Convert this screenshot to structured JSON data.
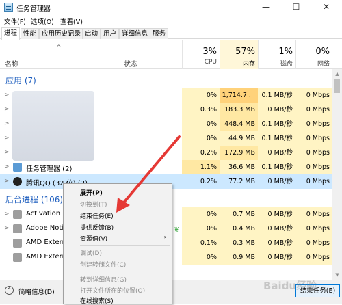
{
  "window": {
    "title": "任务管理器",
    "minimize_glyph": "—",
    "maximize_glyph": "☐",
    "close_glyph": "✕"
  },
  "menu": [
    "文件(F)",
    "选项(O)",
    "查看(V)"
  ],
  "tabs": [
    "进程",
    "性能",
    "应用历史记录",
    "启动",
    "用户",
    "详细信息",
    "服务"
  ],
  "header": {
    "sort_glyph": "^",
    "name": "名称",
    "status": "状态",
    "columns": [
      {
        "pct": "3%",
        "label": "CPU"
      },
      {
        "pct": "57%",
        "label": "内存"
      },
      {
        "pct": "1%",
        "label": "磁盘"
      },
      {
        "pct": "0%",
        "label": "网络"
      }
    ]
  },
  "groups": {
    "apps": "应用 (7)",
    "background": "后台进程 (106)"
  },
  "rows": [
    {
      "name": "",
      "cpu": "0%",
      "mem": "1,714.7 ...",
      "disk": "0.1 MB/秒",
      "net": "0 Mbps"
    },
    {
      "name": "",
      "cpu": "0.3%",
      "mem": "183.3 MB",
      "disk": "0 MB/秒",
      "net": "0 Mbps"
    },
    {
      "name": "",
      "cpu": "0%",
      "mem": "448.4 MB",
      "disk": "0.1 MB/秒",
      "net": "0 Mbps"
    },
    {
      "name": "",
      "cpu": "0%",
      "mem": "44.9 MB",
      "disk": "0.1 MB/秒",
      "net": "0 Mbps"
    },
    {
      "name": "",
      "cpu": "0.2%",
      "mem": "172.9 MB",
      "disk": "0 MB/秒",
      "net": "0 Mbps"
    },
    {
      "name": "任务管理器 (2)",
      "cpu": "1.1%",
      "mem": "36.6 MB",
      "disk": "0.1 MB/秒",
      "net": "0 Mbps"
    },
    {
      "name": "腾讯QQ (32 位) (2)",
      "cpu": "0.2%",
      "mem": "77.2 MB",
      "disk": "0 MB/秒",
      "net": "0 Mbps"
    },
    {
      "name": "Activation Li",
      "cpu": "0%",
      "mem": "0.7 MB",
      "disk": "0 MB/秒",
      "net": "0 Mbps"
    },
    {
      "name": "Adobe Noti",
      "cpu": "0%",
      "mem": "0.4 MB",
      "disk": "0 MB/秒",
      "net": "0 Mbps"
    },
    {
      "name": "AMD Extern",
      "cpu": "0.1%",
      "mem": "0.3 MB",
      "disk": "0 MB/秒",
      "net": "0 Mbps"
    },
    {
      "name": "AMD Extern",
      "cpu": "0%",
      "mem": "0.9 MB",
      "disk": "0 MB/秒",
      "net": "0 Mbps"
    }
  ],
  "context_menu": [
    {
      "label": "展开(P)",
      "state": "bold"
    },
    {
      "label": "切换到(T)",
      "state": "disabled"
    },
    {
      "label": "结束任务(E)",
      "state": "normal"
    },
    {
      "label": "提供反馈(B)",
      "state": "normal"
    },
    {
      "label": "资源值(V)",
      "state": "normal",
      "submenu_glyph": "›"
    },
    {
      "label": "调试(D)",
      "state": "disabled"
    },
    {
      "label": "创建转储文件(C)",
      "state": "disabled"
    },
    {
      "label": "转到详细信息(G)",
      "state": "disabled"
    },
    {
      "label": "打开文件所在的位置(O)",
      "state": "disabled"
    },
    {
      "label": "在线搜索(S)",
      "state": "normal"
    }
  ],
  "statusbar": {
    "toggle_glyph": "^",
    "summary": "简略信息(D)",
    "end_task": "结束任务(E)"
  },
  "watermark": "Baidu经验",
  "colors": {
    "heat_light": "#fff4c4",
    "heat_mid": "#ffe8a3",
    "selection": "#cce8ff",
    "annotation_arrow": "#e53935"
  }
}
